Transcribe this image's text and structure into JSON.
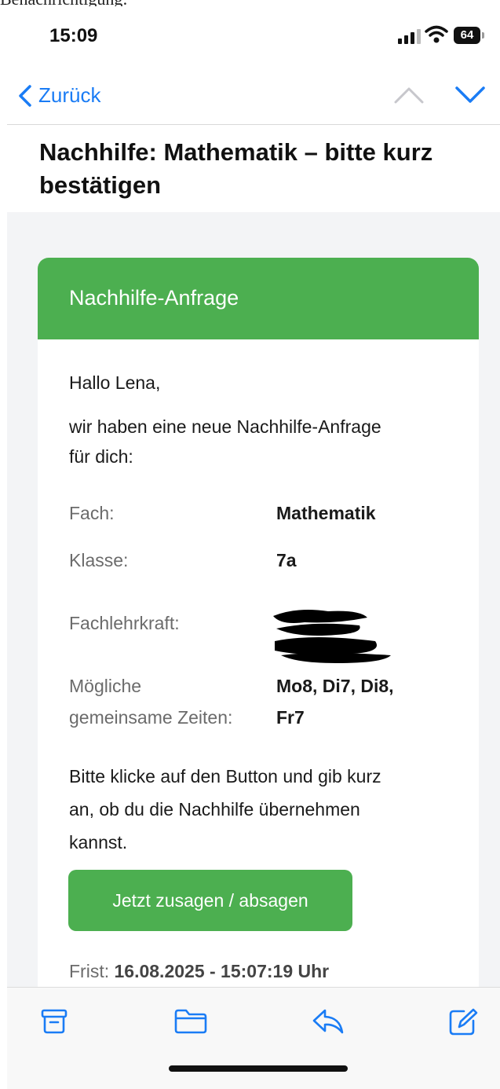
{
  "caption_fragment": "Benachrichtigung:",
  "status": {
    "time": "15:09",
    "battery": "64"
  },
  "nav": {
    "back_label": "Zurück"
  },
  "email": {
    "subject": "Nachhilfe: Mathematik – bitte kurz bestätigen",
    "header": "Nachhilfe-Anfrage",
    "greeting": "Hallo Lena,",
    "intro_line1": "wir haben eine neue Nachhilfe-Anfrage",
    "intro_line2": "für dich:",
    "fields": {
      "subject_label": "Fach:",
      "subject_value": "Mathematik",
      "class_label": "Klasse:",
      "class_value": "7a",
      "teacher_label": "Fachlehrkraft:",
      "times_label_line1": "Mögliche",
      "times_label_line2": "gemeinsame Zeiten:",
      "times_value_line1": "Mo8, Di7, Di8,",
      "times_value_line2": "Fr7"
    },
    "instruction_line1": "Bitte klicke auf den Button und gib kurz",
    "instruction_line2": "an, ob du die Nachhilfe übernehmen",
    "instruction_line3": "kannst.",
    "button_label": "Jetzt zusagen / absagen",
    "deadline_label": "Frist:",
    "deadline_value": "16.08.2025 - 15:07:19 Uhr"
  },
  "colors": {
    "accent_green": "#4caf50",
    "ios_blue": "#1a7cf5",
    "mail_bg": "#f3f4f6"
  },
  "toolbar_icons": [
    "archive-icon",
    "folder-icon",
    "reply-icon",
    "compose-icon"
  ]
}
